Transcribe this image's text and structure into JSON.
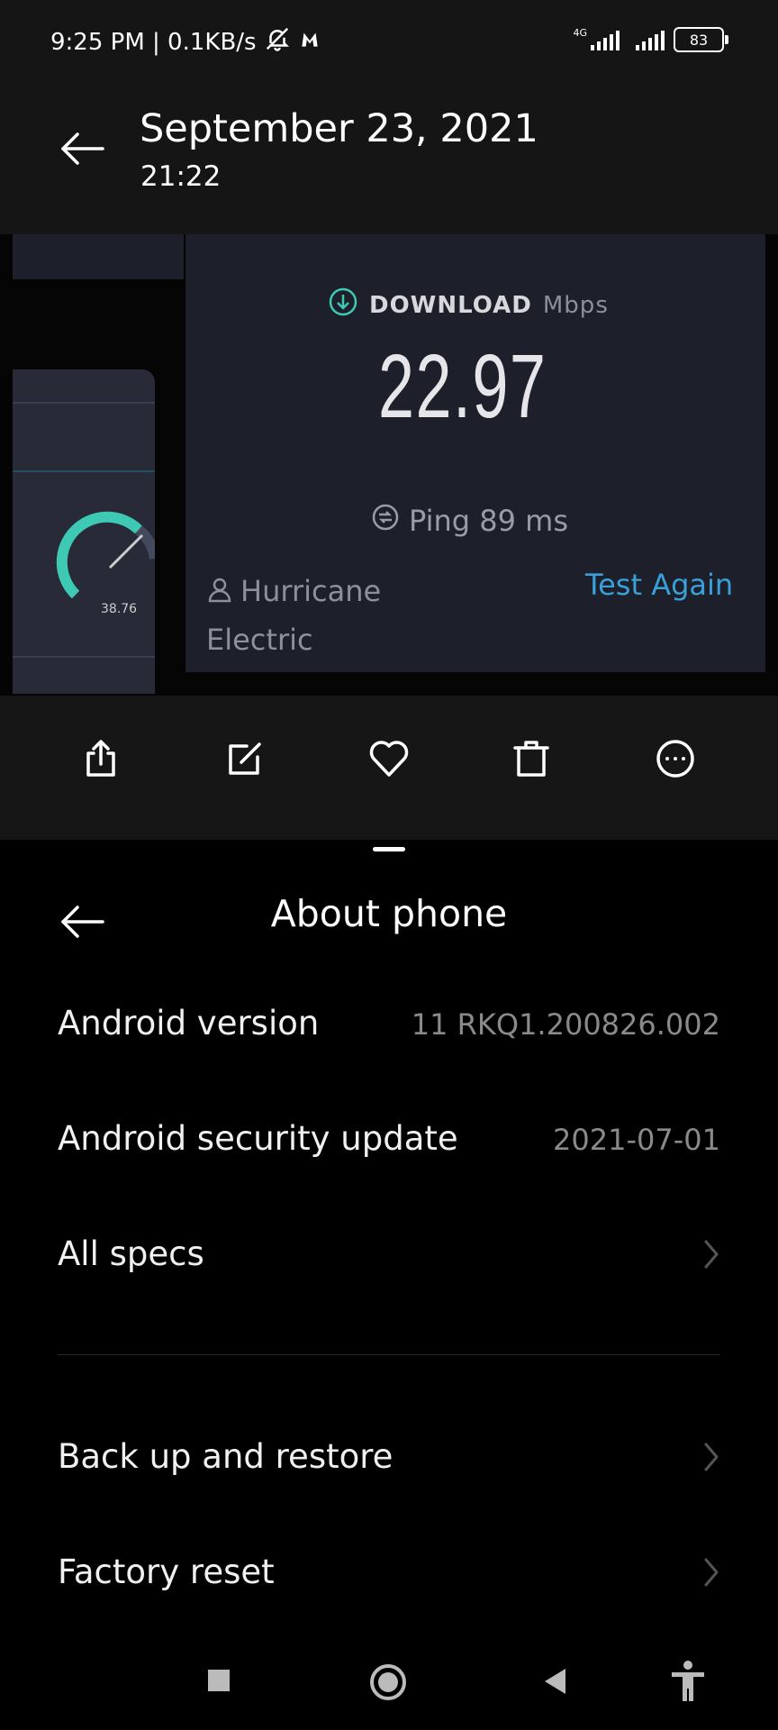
{
  "status_bar": {
    "time_speed": "9:25 PM | 0.1KB/s",
    "network": "4G",
    "battery": "83"
  },
  "gallery": {
    "date": "September 23, 2021",
    "time": "21:22"
  },
  "speedtest": {
    "download_label": "DOWNLOAD",
    "download_unit": "Mbps",
    "download_value": "22.97",
    "ping_label": "Ping 89 ms",
    "provider_line1": "Hurricane",
    "provider_line2": "Electric",
    "test_again": "Test Again",
    "mini_value": "38.76"
  },
  "actions": [
    "share-icon",
    "edit-icon",
    "heart-icon",
    "delete-icon",
    "more-icon"
  ],
  "about": {
    "title": "About phone",
    "rows": [
      {
        "label": "Android version",
        "value": "11 RKQ1.200826.002"
      },
      {
        "label": "Android security update",
        "value": "2021-07-01"
      },
      {
        "label": "All specs",
        "value": ""
      },
      {
        "label": "Back up and restore",
        "value": ""
      },
      {
        "label": "Factory reset",
        "value": ""
      }
    ]
  },
  "navbar": [
    "recents-icon",
    "home-icon",
    "back-icon",
    "accessibility-icon"
  ]
}
